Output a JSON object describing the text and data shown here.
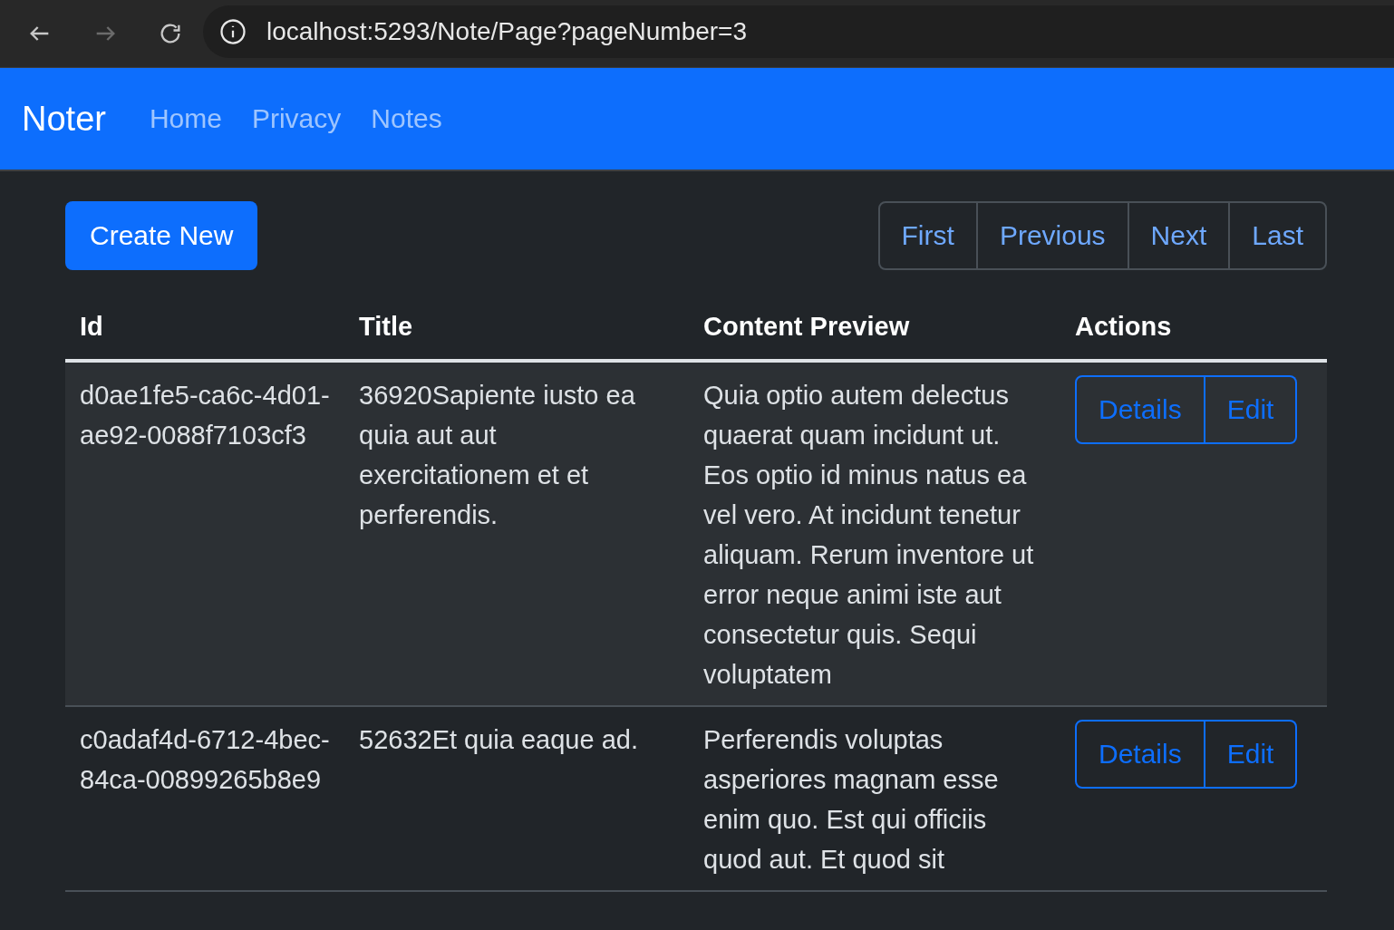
{
  "browser": {
    "buttons": [
      {
        "kind": "back",
        "disabled": false
      },
      {
        "kind": "forward",
        "disabled": true
      },
      {
        "kind": "reload",
        "disabled": false
      }
    ],
    "url": "localhost:5293/Note/Page?pageNumber=3"
  },
  "navbar": {
    "brand": "Noter",
    "links": [
      "Home",
      "Privacy",
      "Notes"
    ]
  },
  "create_button": "Create New",
  "pagination": [
    "First",
    "Previous",
    "Next",
    "Last"
  ],
  "table": {
    "columns": [
      "Id",
      "Title",
      "Content Preview",
      "Actions"
    ],
    "rows": [
      {
        "id": "d0ae1fe5-ca6c-4d01-ae92-0088f7103cf3",
        "title": "36920Sapiente iusto ea quia aut aut exercitationem et et perferendis.",
        "content": "Quia optio autem delectus quaerat quam incidunt ut. Eos optio id minus natus ea vel vero. At incidunt tenetur aliquam. Rerum inventore ut error neque animi iste aut consectetur quis. Sequi voluptatem",
        "actions": [
          "Details",
          "Edit"
        ]
      },
      {
        "id": "c0adaf4d-6712-4bec-84ca-00899265b8e9",
        "title": "52632Et quia eaque ad.",
        "content": "Perferendis voluptas asperiores magnam esse enim quo. Est qui officiis quod aut. Et quod sit",
        "actions": [
          "Details",
          "Edit"
        ]
      }
    ]
  }
}
